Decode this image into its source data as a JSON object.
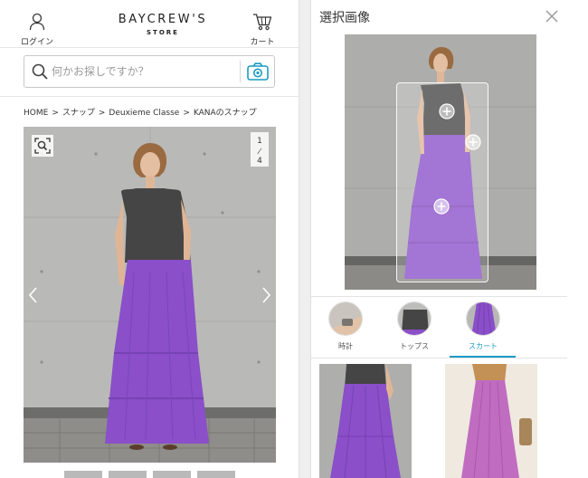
{
  "header": {
    "login_label": "ログイン",
    "cart_label": "カート",
    "brand_line1": "BAYCREW'S",
    "brand_line2": "STORE"
  },
  "search": {
    "placeholder": "何かお探しですか？"
  },
  "breadcrumb": {
    "items": [
      "HOME",
      "スナップ",
      "Deuxieme Classe",
      "KANAのスナップ"
    ],
    "separator": ">"
  },
  "photo": {
    "current_page": "1",
    "page_total": "4"
  },
  "selection_panel": {
    "title": "選択画像",
    "tabs": [
      {
        "label": "時計",
        "active": false
      },
      {
        "label": "トップス",
        "active": false
      },
      {
        "label": "スカート",
        "active": true
      }
    ]
  },
  "colors": {
    "accent": "#1a9bc4",
    "skirt": "#8a4fc9",
    "top": "#454545",
    "wall": "#b6b6b4"
  }
}
